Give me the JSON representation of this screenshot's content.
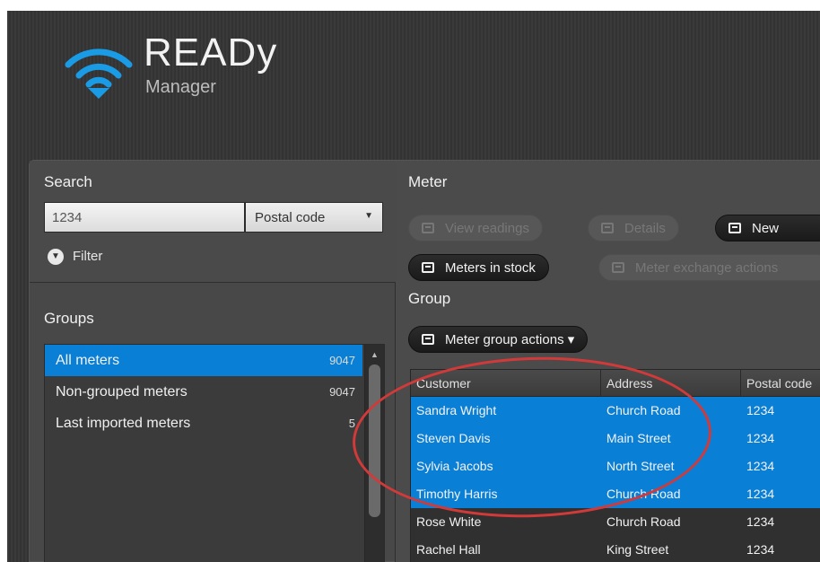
{
  "app": {
    "brand": "READy",
    "subtitle": "Manager",
    "logo_icon": "wifi-download-icon",
    "logo_color": "#1a9be6"
  },
  "search": {
    "label": "Search",
    "value": "1234",
    "field_type": "Postal code",
    "filter_label": "Filter"
  },
  "groups": {
    "label": "Groups",
    "items": [
      {
        "name": "All meters",
        "count": "9047"
      },
      {
        "name": "Non-grouped meters",
        "count": "9047"
      },
      {
        "name": "Last imported meters",
        "count": "5"
      }
    ]
  },
  "meter": {
    "label": "Meter",
    "buttons": {
      "view_readings": "View readings",
      "details": "Details",
      "new": "New",
      "meters_in_stock": "Meters in stock",
      "meter_exchange_actions": "Meter exchange actions"
    }
  },
  "group": {
    "label": "Group",
    "actions_button": "Meter group actions ▾"
  },
  "table": {
    "columns": [
      "Customer",
      "Address",
      "Postal code"
    ],
    "rows": [
      {
        "customer": "Sandra Wright",
        "address": "Church Road",
        "postal": "1234"
      },
      {
        "customer": "Steven Davis",
        "address": "Main Street",
        "postal": "1234"
      },
      {
        "customer": "Sylvia Jacobs",
        "address": "North Street",
        "postal": "1234"
      },
      {
        "customer": "Timothy Harris",
        "address": "Church Road",
        "postal": "1234"
      },
      {
        "customer": "Rose White",
        "address": "Church Road",
        "postal": "1234"
      },
      {
        "customer": "Rachel Hall",
        "address": "King Street",
        "postal": "1234"
      }
    ]
  },
  "colors": {
    "selection": "#0a7fd6",
    "annotation": "#d23a3a"
  }
}
